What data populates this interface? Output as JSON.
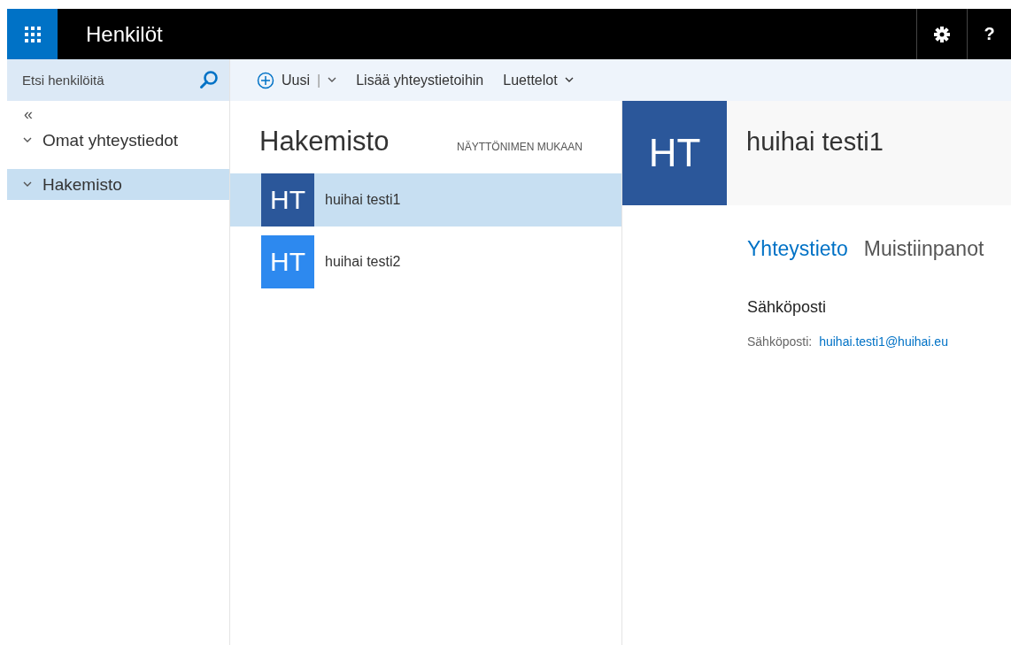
{
  "app_bar": {
    "title": "Henkilöt",
    "help": "?"
  },
  "search": {
    "placeholder": "Etsi henkilöitä"
  },
  "toolbar": {
    "new": "Uusi",
    "separator": "|",
    "add": "Lisää yhteystietoihin",
    "lists": "Luettelot"
  },
  "sidebar": {
    "collapse": "«",
    "items": [
      {
        "label": "Omat yhteystiedot",
        "selected": false
      },
      {
        "label": "Hakemisto",
        "selected": true
      }
    ]
  },
  "list": {
    "title": "Hakemisto",
    "sort": "NÄYTTÖNIMEN MUKAAN",
    "contacts": [
      {
        "initials": "HT",
        "name": "huihai testi1",
        "selected": true,
        "color": "#2b579a"
      },
      {
        "initials": "HT",
        "name": "huihai testi2",
        "selected": false,
        "color": "#2d89ef"
      }
    ]
  },
  "detail": {
    "initials": "HT",
    "name": "huihai testi1",
    "tabs": [
      {
        "label": "Yhteystieto",
        "selected": true
      },
      {
        "label": "Muistiinpanot",
        "selected": false
      }
    ],
    "section": "Sähköposti",
    "field_label": "Sähköposti:",
    "email": "huihai.testi1@huihai.eu"
  }
}
